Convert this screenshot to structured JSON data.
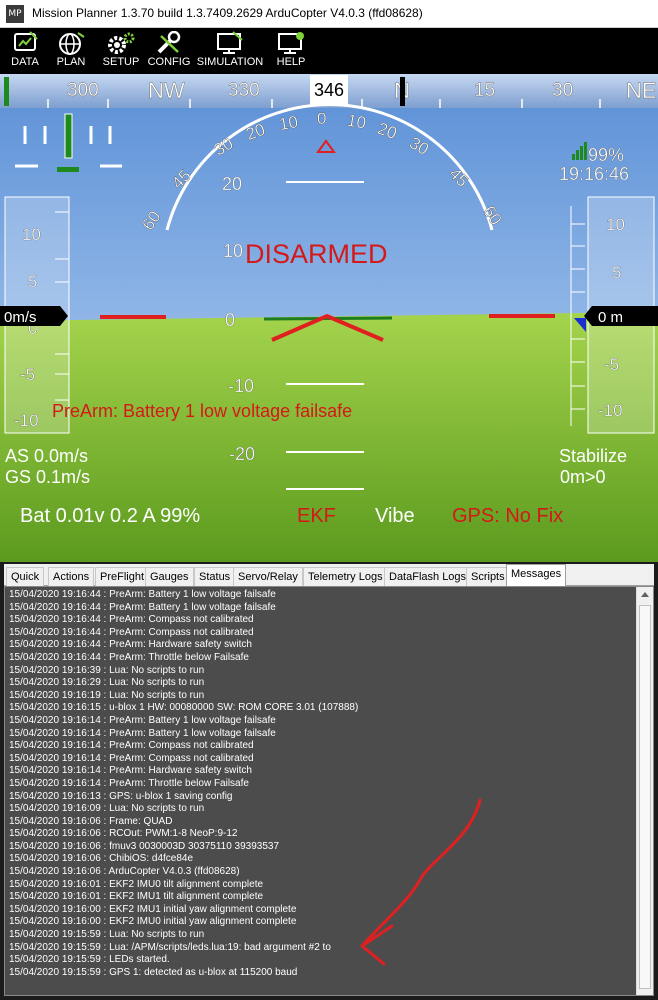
{
  "window": {
    "app_icon_text": "MP",
    "title": "Mission Planner 1.3.70 build 1.3.7409.2629 ArduCopter V4.0.3 (ffd08628)"
  },
  "menu": [
    {
      "label": "DATA",
      "icon": "data-icon"
    },
    {
      "label": "PLAN",
      "icon": "globe-icon"
    },
    {
      "label": "SETUP",
      "icon": "gears-icon"
    },
    {
      "label": "CONFIG",
      "icon": "wrench-icon"
    },
    {
      "label": "SIMULATION",
      "icon": "monitor-plane-icon"
    },
    {
      "label": "HELP",
      "icon": "monitor-help-icon"
    }
  ],
  "hud": {
    "heading_ticks": [
      "300",
      "NW",
      "330",
      "346",
      "N",
      "15",
      "30",
      "NE"
    ],
    "heading_value": "346",
    "roll_scale": [
      "60",
      "45",
      "30",
      "20",
      "10",
      "0",
      "10",
      "20",
      "30",
      "45",
      "60"
    ],
    "pitch_labels": [
      "20",
      "10",
      "0",
      "-10",
      "-20"
    ],
    "speed_tape_labels": [
      "10",
      "5",
      "0",
      "-5",
      "-10"
    ],
    "alt_tape_labels": [
      "10",
      "5",
      "0",
      "-5",
      "-10"
    ],
    "vertical_speed": "0m/s",
    "altitude": "0 m",
    "signal": "99%",
    "time": "19:16:46",
    "armed_status": "DISARMED",
    "prearm_message": "PreArm: Battery 1 low voltage failsafe",
    "airspeed": "AS 0.0m/s",
    "groundspeed": "GS 0.1m/s",
    "mode": "Stabilize",
    "waypoint": "0m>0",
    "battery": "Bat 0.01v 0.2 A 99%",
    "ekf": "EKF",
    "vibe": "Vibe",
    "gps": "GPS: No Fix",
    "colors": {
      "sky": "#7fb0e8",
      "ground": "#8ec63c",
      "warning": "#d41919",
      "horizon_line": "#1e7d1e"
    }
  },
  "tabs": [
    {
      "label": "Quick",
      "active": false
    },
    {
      "label": "Actions",
      "active": false
    },
    {
      "label": "PreFlight",
      "active": false
    },
    {
      "label": "Gauges",
      "active": false
    },
    {
      "label": "Status",
      "active": false
    },
    {
      "label": "Servo/Relay",
      "active": false
    },
    {
      "label": "Telemetry Logs",
      "active": false
    },
    {
      "label": "DataFlash Logs",
      "active": false
    },
    {
      "label": "Scripts",
      "active": false
    },
    {
      "label": "Messages",
      "active": true
    }
  ],
  "messages": [
    "15/04/2020 19:16:44 : PreArm: Battery 1 low voltage failsafe",
    "15/04/2020 19:16:44 : PreArm: Battery 1 low voltage failsafe",
    "15/04/2020 19:16:44 : PreArm: Compass not calibrated",
    "15/04/2020 19:16:44 : PreArm: Compass not calibrated",
    "15/04/2020 19:16:44 : PreArm: Hardware safety switch",
    "15/04/2020 19:16:44 : PreArm: Throttle below Failsafe",
    "15/04/2020 19:16:39 : Lua: No scripts to run",
    "15/04/2020 19:16:29 : Lua: No scripts to run",
    "15/04/2020 19:16:19 : Lua: No scripts to run",
    "15/04/2020 19:16:15 : u-blox 1 HW: 00080000 SW: ROM CORE 3.01 (107888)",
    "15/04/2020 19:16:14 : PreArm: Battery 1 low voltage failsafe",
    "15/04/2020 19:16:14 : PreArm: Battery 1 low voltage failsafe",
    "15/04/2020 19:16:14 : PreArm: Compass not calibrated",
    "15/04/2020 19:16:14 : PreArm: Compass not calibrated",
    "15/04/2020 19:16:14 : PreArm: Hardware safety switch",
    "15/04/2020 19:16:14 : PreArm: Throttle below Failsafe",
    "15/04/2020 19:16:13 : GPS: u-blox 1 saving config",
    "15/04/2020 19:16:09 : Lua: No scripts to run",
    "15/04/2020 19:16:06 : Frame: QUAD",
    "15/04/2020 19:16:06 : RCOut: PWM:1-8 NeoP:9-12",
    "15/04/2020 19:16:06 : fmuv3 0030003D 30375110 39393537",
    "15/04/2020 19:16:06 : ChibiOS: d4fce84e",
    "15/04/2020 19:16:06 : ArduCopter V4.0.3 (ffd08628)",
    "15/04/2020 19:16:01 : EKF2 IMU0 tilt alignment complete",
    "15/04/2020 19:16:01 : EKF2 IMU1 tilt alignment complete",
    "15/04/2020 19:16:00 : EKF2 IMU1 initial yaw alignment complete",
    "15/04/2020 19:16:00 : EKF2 IMU0 initial yaw alignment complete",
    "15/04/2020 19:15:59 : Lua: No scripts to run",
    "15/04/2020 19:15:59 : Lua: /APM/scripts/leds.lua:19: bad argument #2 to",
    "15/04/2020 19:15:59 : LEDs started.",
    "15/04/2020 19:15:59 : GPS 1: detected as u-blox at 115200 baud"
  ],
  "annotation_color": "#e02020"
}
